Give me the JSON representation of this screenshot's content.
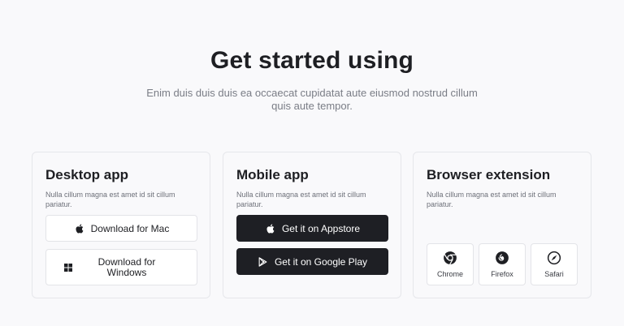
{
  "hero": {
    "title": "Get started using",
    "subtitle": "Enim duis duis duis ea occaecat cupidatat aute eiusmod nostrud cillum quis aute tempor."
  },
  "desktop": {
    "title": "Desktop app",
    "description": "Nulla cillum magna est amet id sit cillum pariatur.",
    "mac_label": "Download for Mac",
    "windows_label": "Download for Windows"
  },
  "mobile": {
    "title": "Mobile app",
    "description": "Nulla cillum magna est amet id sit cillum pariatur.",
    "appstore_label": "Get it on Appstore",
    "googleplay_label": "Get it on Google Play"
  },
  "browser": {
    "title": "Browser extension",
    "description": "Nulla cillum magna est amet id sit cillum pariatur.",
    "items": [
      {
        "label": "Chrome",
        "icon": "chrome-icon"
      },
      {
        "label": "Firefox",
        "icon": "firefox-icon"
      },
      {
        "label": "Safari",
        "icon": "safari-icon"
      }
    ]
  },
  "colors": {
    "background": "#f9f9fb",
    "dark_button": "#1e1f24",
    "muted_text": "#7a7d86"
  }
}
